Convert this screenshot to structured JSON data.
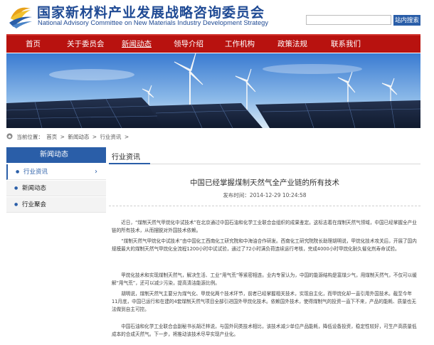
{
  "header": {
    "title_cn": "国家新材料产业发展战略咨询委员会",
    "title_en": "National Advisory Committee on New Materials Industry Development Strategy",
    "search_placeholder": "",
    "search_button": "站内搜索"
  },
  "nav": {
    "items": [
      {
        "label": "首页"
      },
      {
        "label": "关于委员会"
      },
      {
        "label": "新闻动态",
        "active": true
      },
      {
        "label": "领导介绍"
      },
      {
        "label": "工作机构"
      },
      {
        "label": "政策法规"
      },
      {
        "label": "联系我们"
      }
    ]
  },
  "breadcrumb": {
    "prefix": "当前位置：",
    "items": [
      "首页",
      "新闻动态",
      "行业资讯"
    ],
    "separator": ">"
  },
  "sidebar": {
    "heading": "新闻动态",
    "items": [
      {
        "label": "行业资讯",
        "active": true,
        "chevron": "›"
      },
      {
        "label": "新闻动态"
      },
      {
        "label": "行业聚会"
      }
    ]
  },
  "content": {
    "section_title": "行业资讯",
    "article_title": "中国已经掌握煤制天然气全产业链的所有技术",
    "pub_date": "发布时间：2014-12-29 10:24:58",
    "paragraphs": [
      "近日，“煤制天然气甲烷化中试技术”在北京通过中国石油和化学工业联合会组织的成果鉴定。这标志着在煤制天然气领域，中国已经掌握全产业链的所有技术，从而摆脱对外国技术依赖。",
      "“煤制天然气甲烷化中试技术”由中国化工西南化工研究院和中海油合作研发。西南化工研究院院长助理胡明说，甲烷化技术攻关后，开展了国内规模最大的煤制天然气甲烷化全流程1200小时中试试验，通过了72小时满负荷连续运行考核，完成4000小时甲烷化耐久催化剂寿命试验。",
      "甲烷化技术和实现煤制天然气，解决生活、工业“用气荒”等紧密相连。业内专家认为，中国的能源结构是富煤少气，用煤制天然气，不仅可以缓解“用气荒”，还可以减少污染，提高清洁能源比例。",
      "胡明说，煤制天然气主要分为煤气化、甲烷化两个技术环节，前者已经掌握相关技术，实现自主化，而甲烷化却一直引用外国技术。截至今年11月底，中国已运行和在建的4套煤制天然气项目全部引进国外甲烷化技术。依赖国外技术，使得煤制气的投资一直下不来，产品的能耗、质量也无法做到自主可控。",
      "中国石油和化学工业联合会副秘书长胡迁林说，与国外同类技术相比，该技术减少单位产品能耗，降低设备投资，稳定性较好，可生产高质量低成本的合成天然气。下一步，将推动该技术尽早实现产业化。"
    ]
  },
  "colors": {
    "brand_blue": "#1f4a94",
    "nav_red": "#b8120f",
    "accent_blue": "#2a5ea8"
  },
  "icons": {
    "logo": "committee-logo-icon",
    "home": "home-icon",
    "bullet": "bullet-dot",
    "chevron": "chevron-right-icon"
  }
}
